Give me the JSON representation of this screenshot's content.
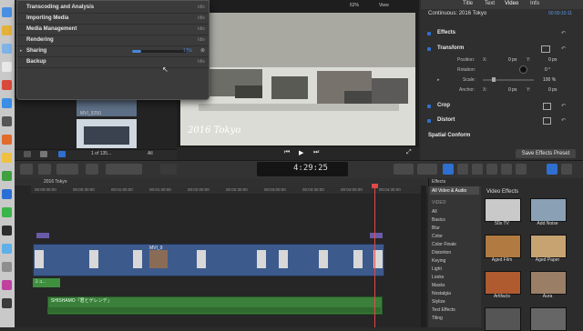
{
  "activity": {
    "rows": [
      {
        "label": "Transcoding and Analysis",
        "status": "Idle"
      },
      {
        "label": "Importing Media",
        "status": "Idle"
      },
      {
        "label": "Media Management",
        "status": "Idle"
      },
      {
        "label": "Rendering",
        "status": "Idle"
      },
      {
        "label": "Sharing",
        "status": "17%",
        "progress": 0.17
      },
      {
        "label": "Backup",
        "status": "Idle"
      }
    ]
  },
  "browser": {
    "clip_name": "MVI_9250",
    "selection_count": "1 of 135...",
    "filter": "All"
  },
  "viewer": {
    "zoom": "62%",
    "view_label": "View",
    "frame_caption": "2016 Tokyo"
  },
  "inspector": {
    "tabs": [
      "Title",
      "Text",
      "Video",
      "Info"
    ],
    "clip_title": "Continuous: 2016 Tokyo",
    "timecode": "00:00:10:11",
    "sections": {
      "effects": "Effects",
      "transform": "Transform",
      "crop": "Crop",
      "distort": "Distort",
      "spatial": "Spatial Conform"
    },
    "position_label": "Position:",
    "x_label": "X:",
    "y_label": "Y:",
    "x_value": "0 px",
    "y_value": "0 px",
    "rotation_label": "Rotation:",
    "rotation_value": "0 °",
    "scale_label": "Scale:",
    "scale_value": "100 %",
    "anchor_label": "Anchor:",
    "anchor_x": "0 px",
    "anchor_y": "0 px",
    "save_preset": "Save Effects Preset",
    "reset_symbol": "↶"
  },
  "toolbar": {
    "timecode": "4:29:25"
  },
  "timeline": {
    "project_name": "2016 Tokyo",
    "ruler_ticks": [
      "00:00:00:00",
      "00:00:30:00",
      "00:01:00:00",
      "00:01:30:00",
      "00:02:00:00",
      "00:02:30:00",
      "00:03:00:00",
      "00:03:30:00",
      "00:04:00:00",
      "00:04:30:00"
    ],
    "clip_label": "MVI_9",
    "audio_clip": "SHISHAMO「君とゲレンデ」",
    "music_label": "ミュ..."
  },
  "effects": {
    "header": "Effects",
    "selected_category": "All Video & Audio",
    "section_video": "VIDEO",
    "categories": [
      "All",
      "Basics",
      "Blur",
      "Color",
      "Color Finale",
      "Distortion",
      "Keying",
      "Light",
      "Looks",
      "Masks",
      "Nostalgia",
      "Stylize",
      "Text Effects",
      "Tiling"
    ],
    "section_title": "Video Effects",
    "items": [
      {
        "name": "50s TV",
        "color": "#c9c9c9"
      },
      {
        "name": "Add Noise",
        "color": "#8aa0b4"
      },
      {
        "name": "Aged Film",
        "color": "#b07a40"
      },
      {
        "name": "Aged Paper",
        "color": "#c7a372"
      },
      {
        "name": "Artifacts",
        "color": "#b05a30"
      },
      {
        "name": "Aura",
        "color": "#9a7f66"
      }
    ]
  },
  "colors": {
    "accent": "#2f6fd0",
    "playhead": "#e24848",
    "audio": "#3f8f3f"
  }
}
